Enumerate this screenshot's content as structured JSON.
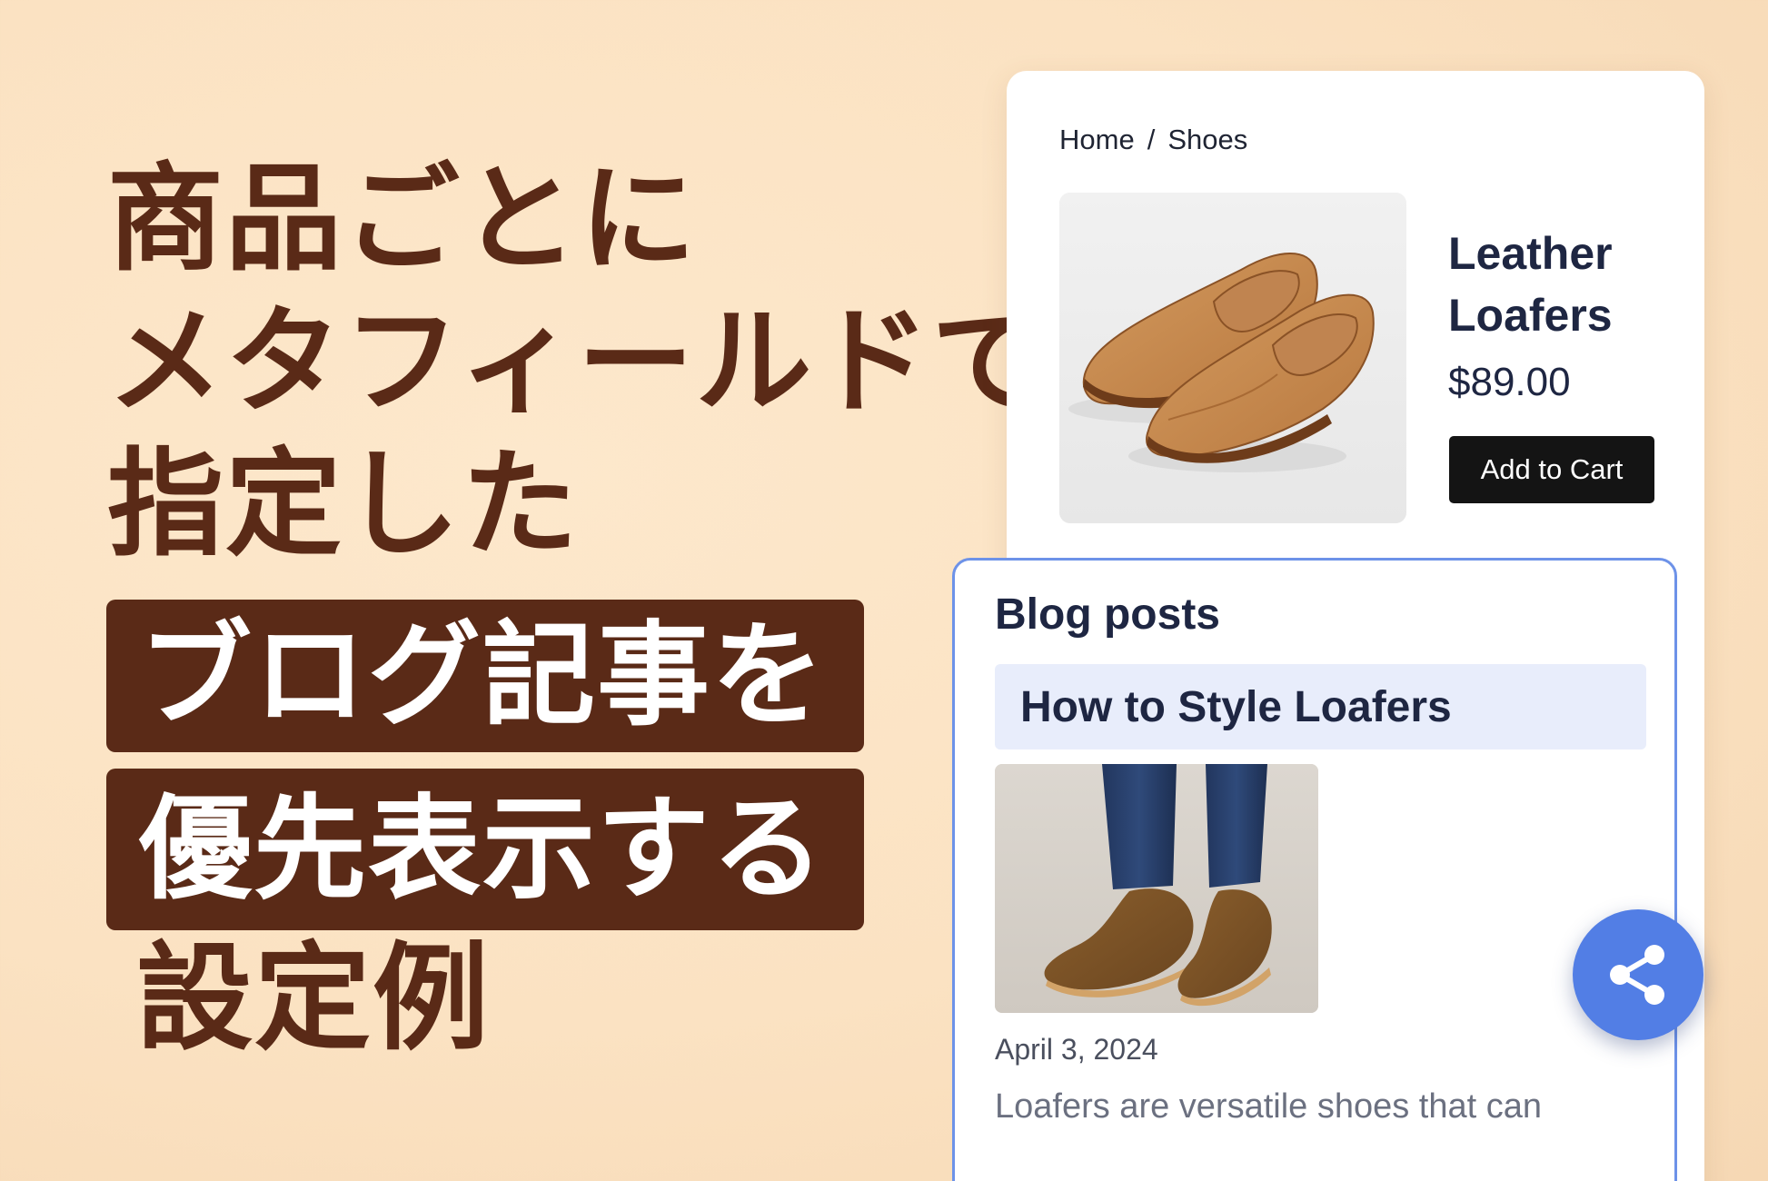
{
  "headline": {
    "line1": "商品ごとに",
    "line2": "メタフィールドで",
    "line3": "指定した",
    "line4": "ブログ記事を",
    "line5": "優先表示する",
    "line6": "設定例"
  },
  "product": {
    "breadcrumb": {
      "home": "Home",
      "separator": "/",
      "current": "Shoes"
    },
    "title_line1": "Leather",
    "title_line2": "Loafers",
    "price": "$89.00",
    "cta_label": "Add to Cart",
    "image_icon": "leather-loafers-photo"
  },
  "blog": {
    "heading": "Blog posts",
    "post_title": "How to Style Loafers",
    "post_image_icon": "suede-loafers-photo",
    "date": "April 3, 2024",
    "excerpt": "Loafers are versatile shoes that can"
  },
  "share": {
    "icon": "share-icon"
  },
  "colors": {
    "background": "#fbe2c2",
    "headline_brown": "#5a2a17",
    "card_border_blue": "#6d92e8",
    "share_blue": "#527ee5",
    "title_bar_bg": "#e8edfb",
    "cta_black": "#141414"
  }
}
